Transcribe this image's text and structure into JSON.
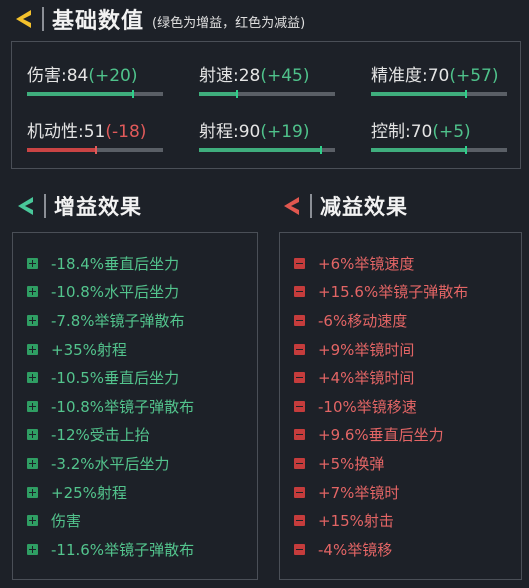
{
  "header": {
    "title": "基础数值",
    "note": "(绿色为增益，红色为减益)"
  },
  "stats": [
    {
      "label": "伤害:84",
      "delta": "(+20)",
      "sign": "pos",
      "level": 0.78
    },
    {
      "label": "射速:28",
      "delta": "(+45)",
      "sign": "pos",
      "level": 0.28
    },
    {
      "label": "精准度:70",
      "delta": "(+57)",
      "sign": "pos",
      "level": 0.7
    },
    {
      "label": "机动性:51",
      "delta": "(-18)",
      "sign": "neg",
      "level": 0.51
    },
    {
      "label": "射程:90",
      "delta": "(+19)",
      "sign": "pos",
      "level": 0.9
    },
    {
      "label": "控制:70",
      "delta": "(+5)",
      "sign": "pos",
      "level": 0.7
    }
  ],
  "buff": {
    "title": "增益效果",
    "items": [
      "-18.4%垂直后坐力",
      "-10.8%水平后坐力",
      "-7.8%举镜子弹散布",
      "+35%射程",
      "-10.5%垂直后坐力",
      "-10.8%举镜子弹散布",
      "-12%受击上抬",
      "-3.2%水平后坐力",
      "+25%射程",
      "伤害",
      "-11.6%举镜子弹散布"
    ]
  },
  "debuff": {
    "title": "减益效果",
    "items": [
      "+6%举镜速度",
      "+15.6%举镜子弹散布",
      "-6%移动速度",
      "+9%举镜时间",
      "+4%举镜时间",
      "-10%举镜移速",
      "+9.6%垂直后坐力",
      "+5%换弹",
      "+7%举镜时",
      "+15%射击",
      "-4%举镜移"
    ]
  },
  "colors": {
    "positive": "#4fc28b",
    "negative": "#e05a5a",
    "accent_yellow": "#f3c12c",
    "background": "#1d2128"
  }
}
